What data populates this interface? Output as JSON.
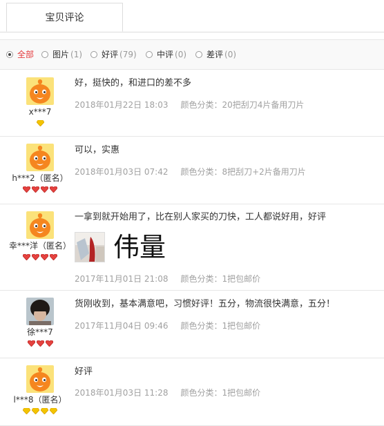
{
  "tabs": [
    {
      "label": "宝贝评论"
    }
  ],
  "filters": [
    {
      "label": "全部",
      "count": ""
    },
    {
      "label": "图片",
      "count": "(1)"
    },
    {
      "label": "好评",
      "count": "(79)"
    },
    {
      "label": "中评",
      "count": "(0)"
    },
    {
      "label": "差评",
      "count": "(0)"
    }
  ],
  "reviews": [
    {
      "user": "x***7",
      "text": "好，挺快的，和进口的差不多",
      "date": "2018年01月22日 18:03",
      "sku": "颜色分类：20把刮刀4片备用刀片",
      "avatar": "taobao-mascot",
      "badge_type": "gold-diamond",
      "badge_count": 1
    },
    {
      "user": "h***2（匿名）",
      "text": "可以，实惠",
      "date": "2018年01月03日 07:42",
      "sku": "颜色分类：8把刮刀+2片备用刀片",
      "avatar": "taobao-mascot",
      "badge_type": "red-heart",
      "badge_count": 4
    },
    {
      "user": "幸***洋（匿名）",
      "text": "一拿到就开始用了，比在别人家买的刀快，工人都说好用，好评",
      "image_text": "伟量",
      "date": "2017年11月01日 21:08",
      "sku": "颜色分类：1把包邮价",
      "avatar": "taobao-mascot",
      "badge_type": "red-heart",
      "badge_count": 4
    },
    {
      "user": "徐***7",
      "text": "货刚收到，基本满意吧，习惯好评！五分，物流很快满意，五分！",
      "date": "2017年11月04日 09:46",
      "sku": "颜色分类：1把包邮价",
      "avatar": "user-photo",
      "badge_type": "red-heart",
      "badge_count": 3
    },
    {
      "user": "l***8（匿名）",
      "text": "好评",
      "date": "2018年01月03日 11:28",
      "sku": "颜色分类：1把包邮价",
      "avatar": "taobao-mascot",
      "badge_type": "gold-diamond",
      "badge_count": 4
    }
  ],
  "colors": {
    "accent": "#e4393c",
    "gold": "#f3c400",
    "heart": "#e5423f",
    "mascot": "#f5861f",
    "muted": "#a0a0a0"
  }
}
